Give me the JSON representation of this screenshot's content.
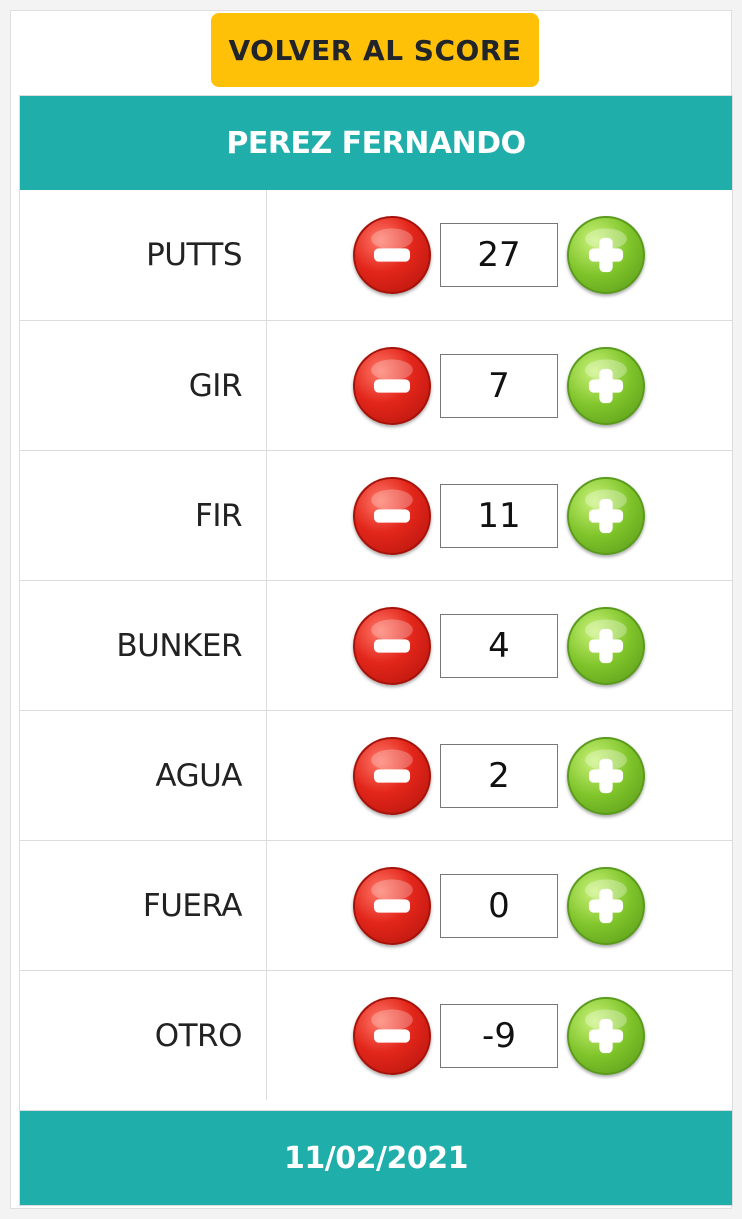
{
  "back_button": {
    "label": "VOLVER AL SCORE"
  },
  "player": {
    "name": "PEREZ FERNANDO"
  },
  "stats": [
    {
      "label": "PUTTS",
      "value": "27"
    },
    {
      "label": "GIR",
      "value": "7"
    },
    {
      "label": "FIR",
      "value": "11"
    },
    {
      "label": "BUNKER",
      "value": "4"
    },
    {
      "label": "AGUA",
      "value": "2"
    },
    {
      "label": "FUERA",
      "value": "0"
    },
    {
      "label": "OTRO",
      "value": "-9"
    }
  ],
  "footer": {
    "date": "11/02/2021"
  },
  "icons": {
    "decrement": "minus-circle-icon",
    "increment": "plus-circle-icon"
  },
  "colors": {
    "accent": "#20aeab",
    "button": "#ffc107",
    "minus": "#e3261b",
    "plus": "#7fc42a"
  }
}
